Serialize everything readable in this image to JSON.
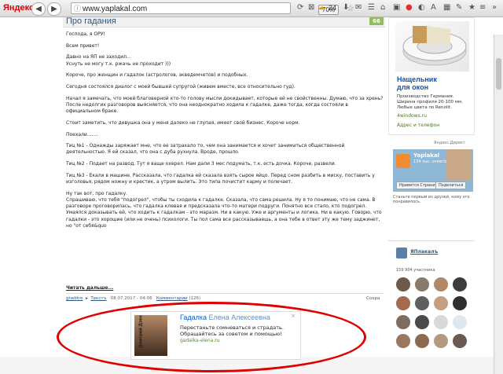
{
  "browser": {
    "logo": "Яндекс",
    "url": "www.yaplakal.com",
    "zoom": "70%",
    "temperature": "24"
  },
  "post": {
    "title": "Про гадания",
    "score": "66",
    "paragraphs": [
      "Господа, я ОРУ!",
      "Всем привет!",
      "Давно на ЯП не заходил...",
      "Уснуть не могу т.к. ржачь не проходит )))",
      "Короче, про женщин и гадалок (астрологов, экведемчетов) и подобных.",
      "Сегодня состоялся диалог с моей бывшей супругой (живем вместе, все относительно гуд).",
      "Начал я замечать, что моей благоверной кто-то голову мысли докидывает, которые ей не свойственны. Думаю, что за хрень? После недолгих разговоров выясняется, что она неоднократно ходила к гадалке, даже тогда, когда состояли в официальном браке.",
      "Стоит заметить, что девушка она у меня далеко не глупая, имеет свой бизнес. Короче норм.",
      "Поехали.......",
      "Тиц №1 - Однажды заряжает мне, что ее затрахало то, чем она занимается и хочет заниматься общественной деятельностью. Я ей сказал, что она с дуба рухнула. Вроде, прошло.",
      "Тиц №2 - Подает на развод. Тут я ваще охерел. Нам дали 3 мес подумать, т.к. есть дочка. Короче, развели.",
      "Тиц №3 - Екали в машине. Рассказала, что гадалка ей сказала взять сырое яйцо. Перед сном разбить в миску, поставить у изголовья, рядом ножну и крестик, а утром вылить. Это типа почистит карму и полечает.",
      "Ну так вот, про гадалку.",
      "Спрашиваю, что тебя \"подогрел\", чтобы ты сходила к гадалке. Сказала, что сама решила. Ну я то понимаю, что не сама. В разговоре проговорилась, что гадалка клевая и предсказала что-то матери подруги. Понятно все стало, кто подогрел.",
      "Умаялся доказывать ей, что ходить к гадалкам - это маразм. Ни в какую. Уже и аргументы и логика. Ни в какую. Говорю, что гадалки - это хорошие (или не очень) психологи. Ты пол сама все рассказываешь, а она тебе в ответ эту же тему заджинет, но \"от себя&quo"
    ],
    "read_more": "Читать дальше...",
    "meta": {
      "author": "gnebtre",
      "section": "Текстъ",
      "date": "08.07.2017 - 04:06",
      "comments_label": "Комментарии",
      "comments_count": "(126)",
      "save": "Сохра"
    }
  },
  "ad_bottom": {
    "side_label": "Дмитрий Дзен",
    "title_first": "Гадалка",
    "title_last": "Елена Алексеевна",
    "close": "×",
    "desc_line1": "Перестаньте сомневаться и страдать.",
    "desc_line2": "Обращайтесь за советом и помощью!",
    "url": "gadalka-elena.ru"
  },
  "sidebar": {
    "ad_title_1": "Нащельник",
    "ad_title_2": "для окон",
    "ad_desc": "Производство Германия. Ширина профиля 20-100 мм. Любые цвета по Renolit.",
    "ad_site": "4windows.ru",
    "ad_address": "Адрес и телефон",
    "ydirect": "Яндекс.Директ",
    "fb_name": "Yaplakal",
    "fb_followers": "134 тыс. отметок",
    "fb_like": "Нравится Страница",
    "fb_share": "Поделиться",
    "fb_friends": "Станьте первым из друзей, кому это понравилось.",
    "vk_title": "ЯПлакалъ",
    "vk_count": "159 904 участника"
  },
  "colors": {
    "accent_red": "#e00000",
    "link_blue": "#34557c",
    "score_green": "#8fbe5a"
  }
}
